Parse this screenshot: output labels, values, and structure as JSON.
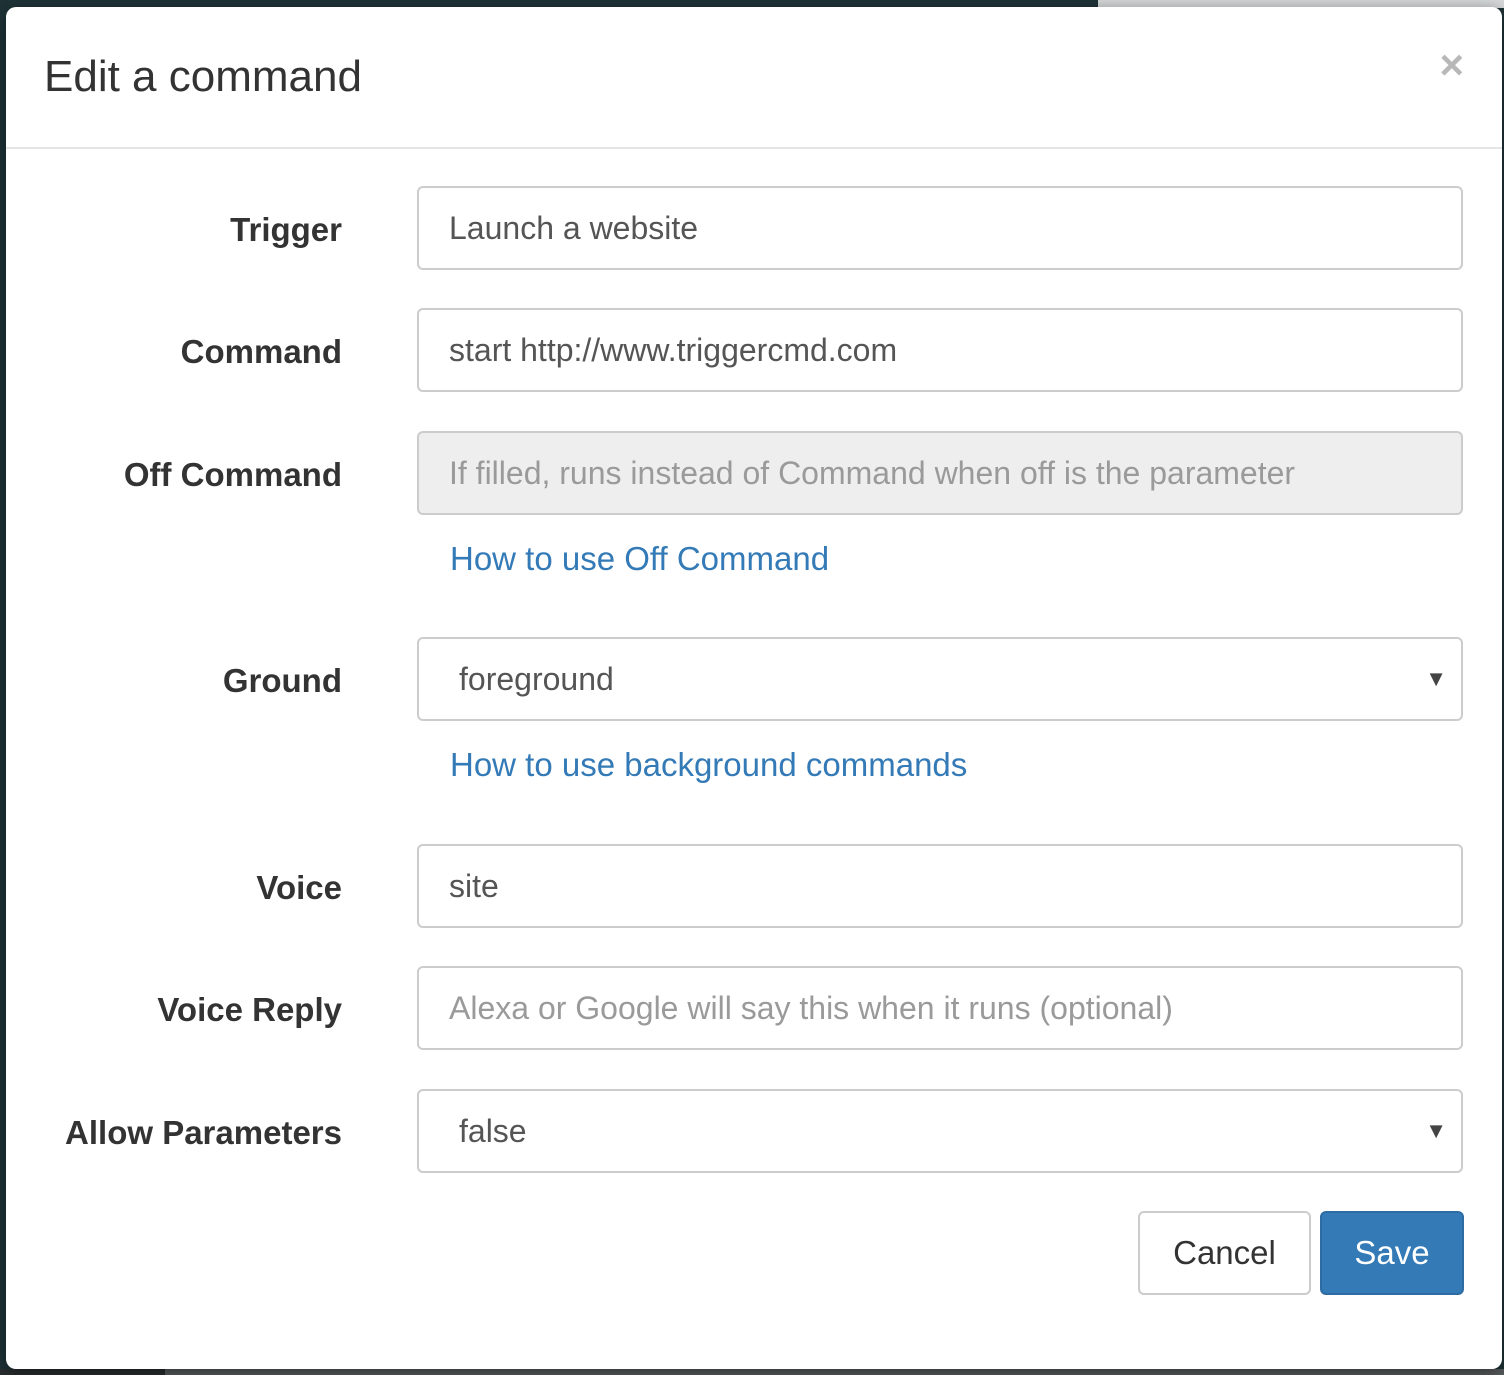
{
  "dialog": {
    "title": "Edit a command",
    "close_glyph": "×",
    "close_icon": "close-icon"
  },
  "form": {
    "trigger": {
      "label": "Trigger",
      "value": "Launch a website"
    },
    "command": {
      "label": "Command",
      "value": "start http://www.triggercmd.com"
    },
    "off_command": {
      "label": "Off Command",
      "value": "",
      "placeholder": "If filled, runs instead of Command when off is the parameter",
      "help_link": "How to use Off Command"
    },
    "ground": {
      "label": "Ground",
      "selected": "foreground",
      "help_link": "How to use background commands"
    },
    "voice": {
      "label": "Voice",
      "value": "site"
    },
    "voice_reply": {
      "label": "Voice Reply",
      "value": "",
      "placeholder": "Alexa or Google will say this when it runs (optional)"
    },
    "allow_parameters": {
      "label": "Allow Parameters",
      "selected": "false"
    }
  },
  "footer": {
    "cancel_label": "Cancel",
    "save_label": "Save"
  },
  "colors": {
    "primary": "#337ab7",
    "link": "#337ab7",
    "disabled_field": "#eeeeee"
  },
  "icons": {
    "select_caret": "chevron-down-icon"
  }
}
